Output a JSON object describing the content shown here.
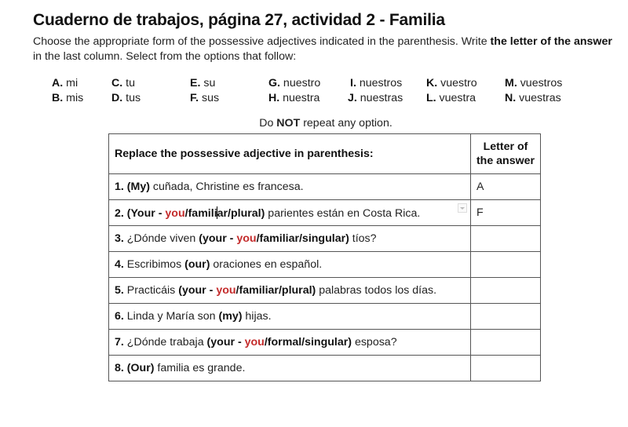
{
  "title": "Cuaderno de trabajos, página 27, actividad 2 - Familia",
  "instructions": {
    "part1": "Choose the appropriate form of the possessive adjectives indicated in the parenthesis. Write ",
    "bold": "the letter of the answer",
    "part2": " in the last column. Select from the options that follow:"
  },
  "options": [
    {
      "letter": "A.",
      "word": " mi"
    },
    {
      "letter": "B.",
      "word": " mis"
    },
    {
      "letter": "C.",
      "word": " tu"
    },
    {
      "letter": "D.",
      "word": " tus"
    },
    {
      "letter": "E.",
      "word": " su"
    },
    {
      "letter": "F.",
      "word": " sus"
    },
    {
      "letter": "G.",
      "word": " nuestro"
    },
    {
      "letter": "H.",
      "word": " nuestra"
    },
    {
      "letter": "I.",
      "word": " nuestros"
    },
    {
      "letter": "J.",
      "word": " nuestras"
    },
    {
      "letter": "K.",
      "word": " vuestro"
    },
    {
      "letter": "L.",
      "word": " vuestra"
    },
    {
      "letter": "M.",
      "word": " vuestros"
    },
    {
      "letter": "N.",
      "word": " vuestras"
    }
  ],
  "note": {
    "pre": "Do ",
    "bold": "NOT",
    "post": " repeat any option."
  },
  "table": {
    "header_question": "Replace the possessive adjective in parenthesis:",
    "header_answer_line1": "Letter of",
    "header_answer_line2": "the answer",
    "rows": [
      {
        "num": "1.",
        "pre": " ",
        "paren_open": "(My)",
        "you": "",
        "paren_rest": "",
        "post": " cuñada, Christine es francesa.",
        "answer": "A"
      },
      {
        "num": "2.",
        "pre": " ",
        "paren_open": "(Your - ",
        "you": "you",
        "paren_rest_a": "/famili",
        "paren_rest_b": "ar/plural)",
        "post": " parientes están en Costa Rica.",
        "answer": "F"
      },
      {
        "num": "3.",
        "pre": " ¿Dónde viven ",
        "paren_open": "(your - ",
        "you": "you",
        "paren_rest": "/familiar/singular)",
        "post": " tíos?",
        "answer": ""
      },
      {
        "num": "4.",
        "pre": " Escribimos ",
        "paren_open": "(our)",
        "you": "",
        "paren_rest": "",
        "post": " oraciones en español.",
        "answer": ""
      },
      {
        "num": "5.",
        "pre": " Practicáis ",
        "paren_open": "(your - ",
        "you": "you",
        "paren_rest": "/familiar/plural)",
        "post": " palabras todos los días.",
        "answer": ""
      },
      {
        "num": "6.",
        "pre": " Linda y María son ",
        "paren_open": "(my)",
        "you": "",
        "paren_rest": "",
        "post": " hijas.",
        "answer": ""
      },
      {
        "num": "7.",
        "pre": " ¿Dónde trabaja ",
        "paren_open": "(your - ",
        "you": "you",
        "paren_rest": "/formal/singular)",
        "post": " esposa?",
        "answer": ""
      },
      {
        "num": "8.",
        "pre": " ",
        "paren_open": "(Our)",
        "you": "",
        "paren_rest": "",
        "post": " familia es grande.",
        "answer": ""
      }
    ]
  },
  "colors": {
    "you_highlight": "#c42b2b"
  },
  "icons": {
    "row2_dropdown": "dropdown-arrow-icon",
    "row2_cursor": "text-cursor"
  }
}
